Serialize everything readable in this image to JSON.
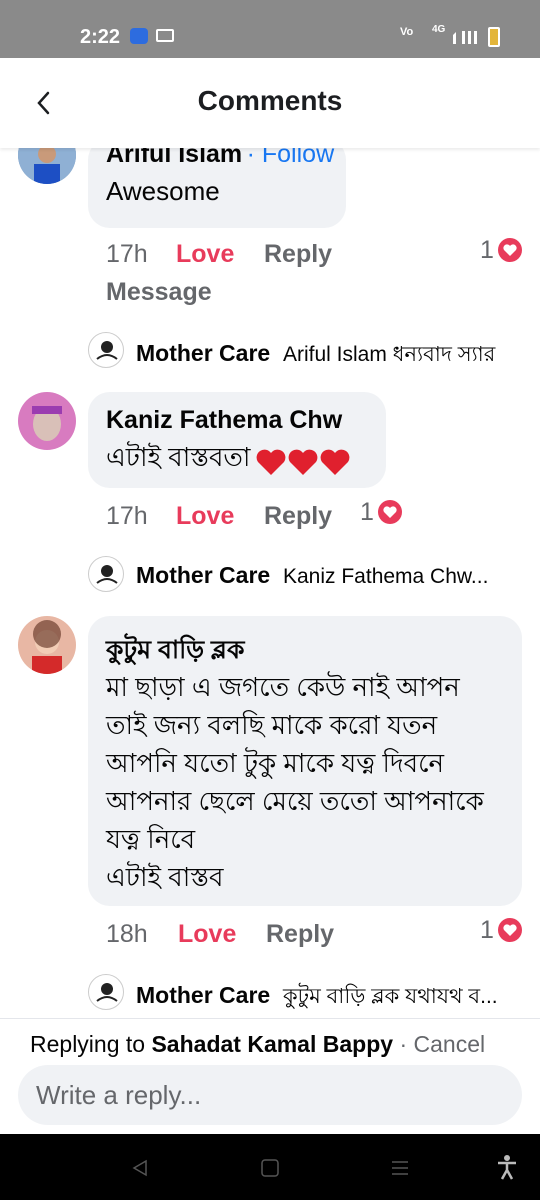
{
  "status_bar": {
    "time": "2:22",
    "network": "4G"
  },
  "header": {
    "title": "Comments"
  },
  "comments": [
    {
      "name": "Ariful Islam",
      "follow": "· Follow",
      "text": "Awesome",
      "time": "17h",
      "love": "Love",
      "reply": "Reply",
      "message": "Message",
      "reaction_count": "1",
      "page_reply": {
        "name": "Mother Care",
        "text": "Ariful Islam ধন্যবাদ স্যার"
      }
    },
    {
      "name": "Kaniz Fathema Chw",
      "text": "এটাই বাস্তবতা",
      "time": "17h",
      "love": "Love",
      "reply": "Reply",
      "reaction_count": "1",
      "page_reply": {
        "name": "Mother Care",
        "text": "Kaniz Fathema Chw..."
      }
    },
    {
      "name": "কুটুম বাড়ি ব্লক",
      "lines": [
        "মা ছাড়া এ জগতে কেউ নাই আপন",
        "তাই জন্য বলছি মাকে করো যতন",
        "আপনি যতো টুকু মাকে যত্ন দিবনে",
        "আপনার ছেলে মেয়ে ততো আপনাকে",
        "যত্ন নিবে",
        "এটাই বাস্তব"
      ],
      "time": "18h",
      "love": "Love",
      "reply": "Reply",
      "reaction_count": "1",
      "page_reply": {
        "name": "Mother Care",
        "text": "কুটুম বাড়ি ব্লক যথাযথ ব..."
      }
    }
  ],
  "reply_bar": {
    "prefix": "Replying to",
    "name": "Sahadat Kamal Bappy",
    "cancel": "· Cancel",
    "placeholder": "Write a reply..."
  },
  "colors": {
    "love": "#e83b5b",
    "follow": "#1877f2",
    "bubble": "#f0f2f5",
    "muted": "#65676b"
  },
  "icons": [
    "chevron-left-icon",
    "heart-icon",
    "back-triangle-icon",
    "home-square-icon",
    "menu-lines-icon",
    "accessibility-icon"
  ]
}
